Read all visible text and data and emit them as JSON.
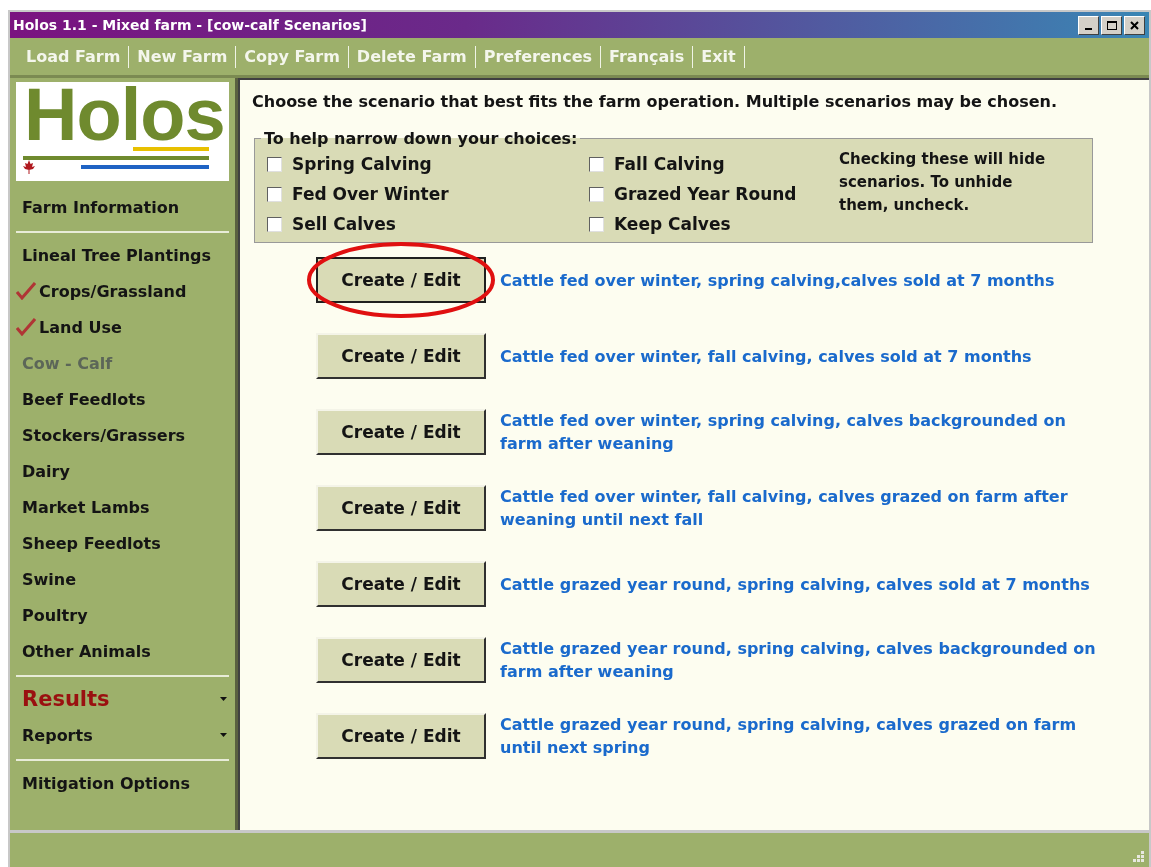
{
  "window": {
    "title": "Holos 1.1 - Mixed farm - [cow-calf Scenarios]"
  },
  "menu_bar": [
    "Load Farm",
    "New Farm",
    "Copy Farm",
    "Delete Farm",
    "Preferences",
    "Français",
    "Exit"
  ],
  "logo": {
    "text": "Holos"
  },
  "sidebar": {
    "groups": [
      [
        {
          "label": "Farm Information",
          "kind": "link",
          "checked": false,
          "disabled": false
        }
      ],
      [
        {
          "label": "Lineal Tree Plantings",
          "kind": "link",
          "checked": false,
          "disabled": false
        },
        {
          "label": "Crops/Grassland",
          "kind": "link",
          "checked": true,
          "disabled": false
        },
        {
          "label": "Land Use",
          "kind": "link",
          "checked": true,
          "disabled": false
        },
        {
          "label": "Cow - Calf",
          "kind": "link",
          "checked": false,
          "disabled": true
        },
        {
          "label": "Beef Feedlots",
          "kind": "link",
          "checked": false,
          "disabled": false
        },
        {
          "label": "Stockers/Grassers",
          "kind": "link",
          "checked": false,
          "disabled": false
        },
        {
          "label": "Dairy",
          "kind": "link",
          "checked": false,
          "disabled": false
        },
        {
          "label": "Market Lambs",
          "kind": "link",
          "checked": false,
          "disabled": false
        },
        {
          "label": "Sheep Feedlots",
          "kind": "link",
          "checked": false,
          "disabled": false
        },
        {
          "label": "Swine",
          "kind": "link",
          "checked": false,
          "disabled": false
        },
        {
          "label": "Poultry",
          "kind": "link",
          "checked": false,
          "disabled": false
        },
        {
          "label": "Other Animals",
          "kind": "link",
          "checked": false,
          "disabled": false
        }
      ],
      [
        {
          "label": "Results",
          "kind": "emphasis-menu",
          "checked": false,
          "disabled": false
        },
        {
          "label": "Reports",
          "kind": "menu",
          "checked": false,
          "disabled": false
        }
      ],
      [
        {
          "label": "Mitigation Options",
          "kind": "link",
          "checked": false,
          "disabled": false
        }
      ]
    ]
  },
  "instruction": "Choose the scenario that best fits the farm operation. Multiple scenarios may be chosen.",
  "filters": {
    "legend": "To help narrow down your choices:",
    "note": "Checking these will hide scenarios. To unhide them, uncheck.",
    "options": [
      {
        "label": "Spring Calving",
        "checked": false
      },
      {
        "label": "Fall Calving",
        "checked": false
      },
      {
        "label": "Fed Over Winter",
        "checked": false
      },
      {
        "label": "Grazed Year Round",
        "checked": false
      },
      {
        "label": "Sell Calves",
        "checked": false
      },
      {
        "label": "Keep Calves",
        "checked": false
      }
    ]
  },
  "scenarios": [
    {
      "button": "Create / Edit",
      "description": "Cattle fed over winter, spring calving,calves sold at 7 months",
      "highlighted": true
    },
    {
      "button": "Create / Edit",
      "description": "Cattle fed over winter, fall calving, calves sold at 7 months",
      "highlighted": false
    },
    {
      "button": "Create / Edit",
      "description": "Cattle fed over winter, spring calving, calves backgrounded on farm after weaning",
      "highlighted": false
    },
    {
      "button": "Create / Edit",
      "description": "Cattle fed over winter, fall calving, calves grazed on farm after weaning until next fall",
      "highlighted": false
    },
    {
      "button": "Create / Edit",
      "description": "Cattle grazed year round, spring calving, calves sold at 7 months",
      "highlighted": false
    },
    {
      "button": "Create / Edit",
      "description": "Cattle grazed year round, spring calving, calves backgrounded on farm after weaning",
      "highlighted": false
    },
    {
      "button": "Create / Edit",
      "description": "Cattle grazed year round, spring calving, calves grazed on farm until next spring",
      "highlighted": false
    }
  ]
}
